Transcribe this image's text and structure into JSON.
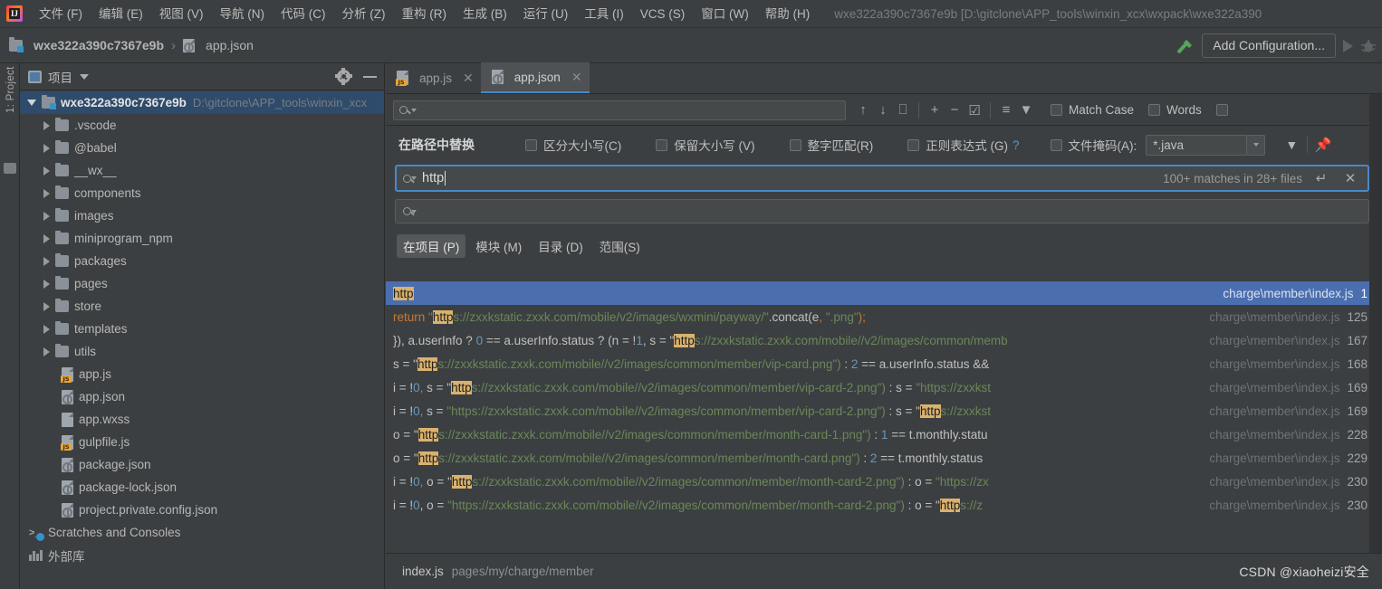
{
  "menubar": {
    "logo": "intellij-logo",
    "items": [
      {
        "label": "文件 (F)"
      },
      {
        "label": "编辑 (E)"
      },
      {
        "label": "视图 (V)"
      },
      {
        "label": "导航 (N)"
      },
      {
        "label": "代码 (C)"
      },
      {
        "label": "分析 (Z)"
      },
      {
        "label": "重构 (R)"
      },
      {
        "label": "生成 (B)"
      },
      {
        "label": "运行 (U)"
      },
      {
        "label": "工具 (I)"
      },
      {
        "label": "VCS (S)"
      },
      {
        "label": "窗口 (W)"
      },
      {
        "label": "帮助 (H)"
      }
    ],
    "window_title": "wxe322a390c7367e9b [D:\\gitclone\\APP_tools\\winxin_xcx\\wxpack\\wxe322a390"
  },
  "navbar": {
    "project_crumb": "wxe322a390c7367e9b",
    "separator": "›",
    "file_crumb": "app.json",
    "add_configuration": "Add Configuration..."
  },
  "leftstrip": {
    "project_tab": "1: Project"
  },
  "project_panel": {
    "title": "项目",
    "root": {
      "label": "wxe322a390c7367e9b",
      "path": "D:\\gitclone\\APP_tools\\winxin_xcx"
    },
    "nodes": [
      {
        "label": ".vscode",
        "type": "folder"
      },
      {
        "label": "@babel",
        "type": "folder"
      },
      {
        "label": "__wx__",
        "type": "folder"
      },
      {
        "label": "components",
        "type": "folder"
      },
      {
        "label": "images",
        "type": "folder"
      },
      {
        "label": "miniprogram_npm",
        "type": "folder"
      },
      {
        "label": "packages",
        "type": "folder"
      },
      {
        "label": "pages",
        "type": "folder"
      },
      {
        "label": "store",
        "type": "folder"
      },
      {
        "label": "templates",
        "type": "folder"
      },
      {
        "label": "utils",
        "type": "folder"
      },
      {
        "label": "app.js",
        "type": "js"
      },
      {
        "label": "app.json",
        "type": "json"
      },
      {
        "label": "app.wxss",
        "type": "wxss"
      },
      {
        "label": "gulpfile.js",
        "type": "js"
      },
      {
        "label": "package.json",
        "type": "json"
      },
      {
        "label": "package-lock.json",
        "type": "json"
      },
      {
        "label": "project.private.config.json",
        "type": "json"
      }
    ],
    "scratches": "Scratches and Consoles",
    "external_libs": "外部库"
  },
  "editor_tabs": [
    {
      "label": "app.js",
      "type": "js",
      "active": false
    },
    {
      "label": "app.json",
      "type": "json",
      "active": true
    }
  ],
  "find_toolbar": {
    "search_placeholder": "",
    "match_case_label": "Match Case",
    "words_label": "Words"
  },
  "replace_panel": {
    "title": "在路径中替换",
    "options": [
      {
        "label": "区分大小写(C)",
        "checked": false
      },
      {
        "label": "保留大小写 (V)",
        "checked": false
      },
      {
        "label": "整字匹配(R)",
        "checked": false
      },
      {
        "label": "正则表达式 (G)",
        "checked": false,
        "help": "?"
      },
      {
        "label": "文件掩码(A):",
        "checked": false
      }
    ],
    "file_mask_value": "*.java",
    "search_value": "http",
    "replace_value": "",
    "matches_text": "100+ matches in 28+ files",
    "scopes": [
      {
        "label": "在项目 (P)",
        "selected": true
      },
      {
        "label": "模块 (M)",
        "selected": false
      },
      {
        "label": "目录 (D)",
        "selected": false
      },
      {
        "label": "范围(S)",
        "selected": false
      }
    ]
  },
  "results": {
    "rows": [
      {
        "selected": true,
        "segments": [
          {
            "t": "http",
            "c": "hl"
          }
        ],
        "file": "charge\\member\\index.js",
        "line": "1"
      },
      {
        "selected": false,
        "segments": [
          {
            "t": "return ",
            "c": "o"
          },
          {
            "t": "\"",
            "c": "g"
          },
          {
            "t": "http",
            "c": "hl"
          },
          {
            "t": "s://zxxkstatic.zxxk.com/mobile/v2/images/wxmini/payway/\"",
            "c": "g"
          },
          {
            "t": ".concat(",
            "c": "w"
          },
          {
            "t": "e",
            "c": "w"
          },
          {
            "t": ", ",
            "c": "o"
          },
          {
            "t": "\".png\"",
            "c": "g"
          },
          {
            "t": ");",
            "c": "o"
          }
        ],
        "file": "charge\\member\\index.js",
        "line": "125"
      },
      {
        "selected": false,
        "segments": [
          {
            "t": "}), a.userInfo ? ",
            "c": "w"
          },
          {
            "t": "0",
            "c": "b"
          },
          {
            "t": " == a.userInfo.status ? (n = !",
            "c": "w"
          },
          {
            "t": "1",
            "c": "b"
          },
          {
            "t": ", s = \"",
            "c": "w"
          },
          {
            "t": "http",
            "c": "hl"
          },
          {
            "t": "s://zxxkstatic.zxxk.com/mobile//v2/images/common/memb",
            "c": "g"
          }
        ],
        "file": "charge\\member\\index.js",
        "line": "167"
      },
      {
        "selected": false,
        "segments": [
          {
            "t": "s = \"",
            "c": "w"
          },
          {
            "t": "http",
            "c": "hl"
          },
          {
            "t": "s://zxxkstatic.zxxk.com/mobile//v2/images/common/member/vip-card.png\")",
            "c": "g"
          },
          {
            "t": " : ",
            "c": "w"
          },
          {
            "t": "2",
            "c": "b"
          },
          {
            "t": " == a.userInfo.status &&",
            "c": "w"
          }
        ],
        "file": "charge\\member\\index.js",
        "line": "168"
      },
      {
        "selected": false,
        "segments": [
          {
            "t": "i = !",
            "c": "w"
          },
          {
            "t": "0",
            "c": "b"
          },
          {
            "t": ", ",
            "c": "o"
          },
          {
            "t": "s = \"",
            "c": "w"
          },
          {
            "t": "http",
            "c": "hl"
          },
          {
            "t": "s://zxxkstatic.zxxk.com/mobile//v2/images/common/member/vip-card-2.png\")",
            "c": "g"
          },
          {
            "t": " : s = ",
            "c": "w"
          },
          {
            "t": "\"https://zxxkst",
            "c": "g"
          }
        ],
        "file": "charge\\member\\index.js",
        "line": "169"
      },
      {
        "selected": false,
        "segments": [
          {
            "t": "i = !",
            "c": "w"
          },
          {
            "t": "0",
            "c": "b"
          },
          {
            "t": ", ",
            "c": "o"
          },
          {
            "t": "s = ",
            "c": "w"
          },
          {
            "t": "\"https://zxxkstatic.zxxk.com/mobile//v2/images/common/member/vip-card-2.png\")",
            "c": "g"
          },
          {
            "t": " : s = \"",
            "c": "w"
          },
          {
            "t": "http",
            "c": "hl"
          },
          {
            "t": "s://zxxkst",
            "c": "g"
          }
        ],
        "file": "charge\\member\\index.js",
        "line": "169"
      },
      {
        "selected": false,
        "segments": [
          {
            "t": "o = \"",
            "c": "w"
          },
          {
            "t": "http",
            "c": "hl"
          },
          {
            "t": "s://zxxkstatic.zxxk.com/mobile//v2/images/common/member/month-card-1.png\")",
            "c": "g"
          },
          {
            "t": " : ",
            "c": "w"
          },
          {
            "t": "1",
            "c": "b"
          },
          {
            "t": " == t.monthly.statu",
            "c": "w"
          }
        ],
        "file": "charge\\member\\index.js",
        "line": "228"
      },
      {
        "selected": false,
        "segments": [
          {
            "t": "o = \"",
            "c": "w"
          },
          {
            "t": "http",
            "c": "hl"
          },
          {
            "t": "s://zxxkstatic.zxxk.com/mobile//v2/images/common/member/month-card.png\")",
            "c": "g"
          },
          {
            "t": " : ",
            "c": "w"
          },
          {
            "t": "2",
            "c": "b"
          },
          {
            "t": " == t.monthly.status ",
            "c": "w"
          }
        ],
        "file": "charge\\member\\index.js",
        "line": "229"
      },
      {
        "selected": false,
        "segments": [
          {
            "t": "i = !",
            "c": "w"
          },
          {
            "t": "0",
            "c": "b"
          },
          {
            "t": ", ",
            "c": "o"
          },
          {
            "t": "o = \"",
            "c": "w"
          },
          {
            "t": "http",
            "c": "hl"
          },
          {
            "t": "s://zxxkstatic.zxxk.com/mobile//v2/images/common/member/month-card-2.png\")",
            "c": "g"
          },
          {
            "t": " : o = ",
            "c": "w"
          },
          {
            "t": "\"https://zx",
            "c": "g"
          }
        ],
        "file": "charge\\member\\index.js",
        "line": "230"
      },
      {
        "selected": false,
        "segments": [
          {
            "t": "i = !",
            "c": "w"
          },
          {
            "t": "0",
            "c": "b"
          },
          {
            "t": ", o = ",
            "c": "w"
          },
          {
            "t": "\"https://zxxkstatic.zxxk.com/mobile//v2/images/common/member/month-card-2.png\")",
            "c": "g"
          },
          {
            "t": " : o = \"",
            "c": "w"
          },
          {
            "t": "http",
            "c": "hl"
          },
          {
            "t": "s://z",
            "c": "g"
          }
        ],
        "file": "charge\\member\\index.js",
        "line": "230"
      }
    ]
  },
  "statusbar": {
    "file": "index.js",
    "path": "pages/my/charge/member",
    "watermark": "CSDN @xiaoheizi安全"
  },
  "colors": {
    "accent_blue": "#4a88c7",
    "selection_blue": "#4b6eaf",
    "highlight_yellow": "#d9b26e",
    "string_green": "#6a8759",
    "keyword_orange": "#cc7832",
    "number_blue": "#6897bb",
    "panel_bg": "#3c3f41"
  }
}
